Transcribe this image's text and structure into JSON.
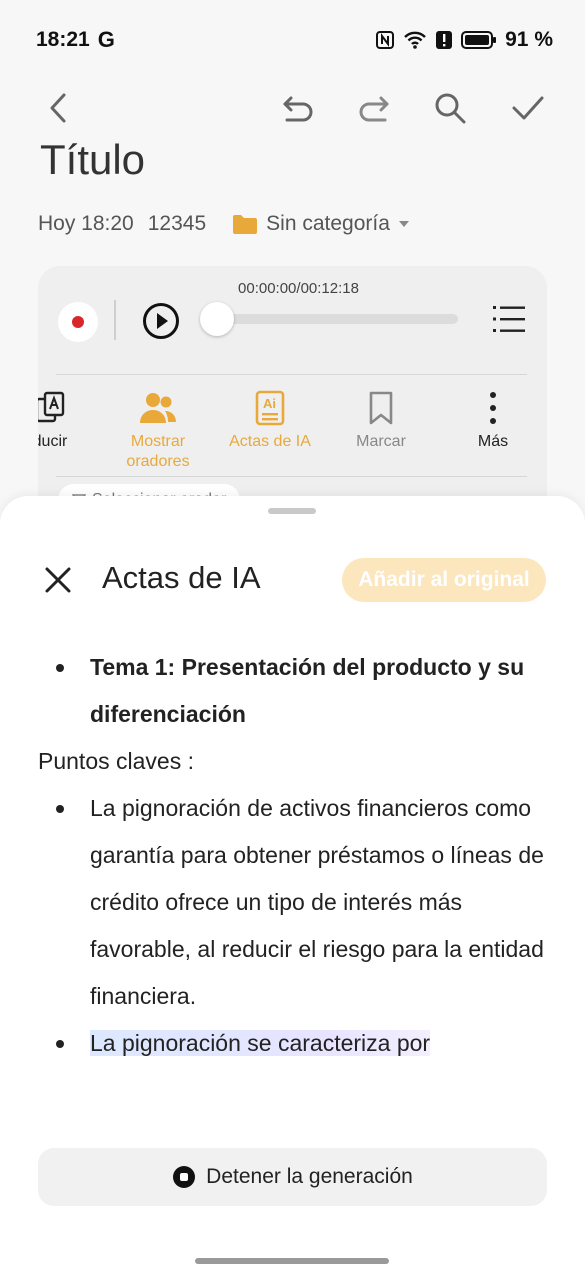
{
  "status_bar": {
    "time": "18:21",
    "google": "G",
    "battery": "91 %"
  },
  "note": {
    "title": "Título",
    "date": "Hoy 18:20",
    "word_count": "12345",
    "category": "Sin categoría"
  },
  "player": {
    "time": "00:00:00/00:12:18",
    "progress": 0
  },
  "tools": [
    {
      "label": "ducir",
      "icon": "translate-icon"
    },
    {
      "label": "Mostrar oradores",
      "icon": "speakers-icon"
    },
    {
      "label": "Actas de IA",
      "icon": "ai-minutes-icon"
    },
    {
      "label": "Marcar",
      "icon": "bookmark-icon"
    },
    {
      "label": "Más",
      "icon": "more-vertical-icon"
    }
  ],
  "chip": {
    "label": "Seleccionar orador"
  },
  "sheet": {
    "title": "Actas de IA",
    "add_button": "Añadir al original",
    "topic": "Tema 1:  Presentación del producto y su diferenciación",
    "key_points_label": "Puntos claves :",
    "point1": "La pignoración de activos financieros como garantía para obtener préstamos o líneas de crédito ofrece un tipo de interés más favorable, al reducir el riesgo para la entidad financiera.",
    "point2": "La pignoración se caracteriza por",
    "stop_button": "Detener la generación"
  },
  "colors": {
    "accent": "#e9a93a",
    "record": "#d8262b",
    "add_button_bg": "#fbe6bd"
  }
}
